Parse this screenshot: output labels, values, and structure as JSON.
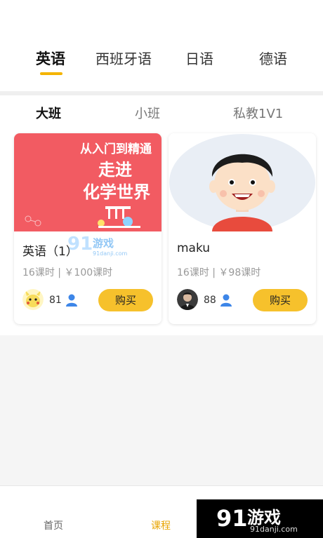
{
  "lang_tabs": [
    {
      "label": "英语",
      "active": true
    },
    {
      "label": "西班牙语",
      "active": false
    },
    {
      "label": "日语",
      "active": false
    },
    {
      "label": "德语",
      "active": false
    }
  ],
  "class_tabs": [
    {
      "label": "大班",
      "active": true
    },
    {
      "label": "小班",
      "active": false
    },
    {
      "label": "私教1V1",
      "active": false
    }
  ],
  "courses": [
    {
      "banner_lines": [
        "从入门到精通",
        "走进",
        "化学世界"
      ],
      "title": "英语（1）",
      "meta": "16课时 | ￥100课时",
      "count": "81",
      "buy_label": "购买"
    },
    {
      "title": "maku",
      "meta": "16课时 | ￥98课时",
      "count": "88",
      "buy_label": "购买"
    }
  ],
  "nav": [
    {
      "label": "首页",
      "active": false
    },
    {
      "label": "课程",
      "active": true
    }
  ],
  "watermark": {
    "title": "游戏",
    "url": "91danji.com",
    "overlay_text": "游戏"
  },
  "colors": {
    "accent": "#f4b400",
    "buy": "#f6c12c",
    "banner": "#f25b62"
  },
  "icons": [
    "person-icon",
    "chemistry-flask-icon",
    "pikachu-avatar",
    "portrait-avatar",
    "cartoon-boy-avatar"
  ]
}
